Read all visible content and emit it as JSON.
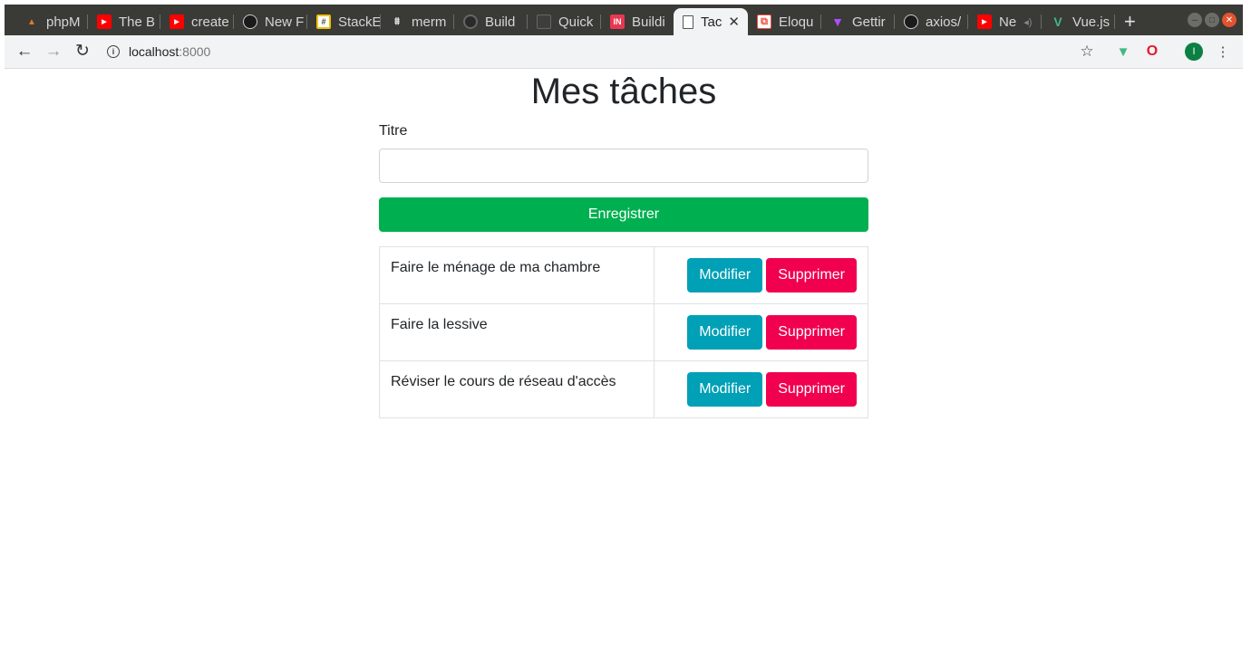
{
  "browser": {
    "tabs": [
      {
        "title": "phpM",
        "favicon": "phpmyadmin-icon",
        "color": "#e07b1f"
      },
      {
        "title": "The B",
        "favicon": "youtube-icon",
        "color": "#ff0000"
      },
      {
        "title": "create",
        "favicon": "youtube-icon",
        "color": "#ff0000"
      },
      {
        "title": "New F",
        "favicon": "github-icon",
        "color": "#1b1b1b"
      },
      {
        "title": "StackE",
        "favicon": "stackedit-icon",
        "color": "#f0c000"
      },
      {
        "title": "merm",
        "favicon": "mermaid-icon",
        "color": "#5a5a5a"
      },
      {
        "title": "Build",
        "favicon": "build-icon",
        "color": "#444444"
      },
      {
        "title": "Quick",
        "favicon": "document-icon",
        "color": "#555555"
      },
      {
        "title": "Buildi",
        "favicon": "in-icon",
        "color": "#e8384f"
      },
      {
        "title": "Tac",
        "favicon": "page-icon",
        "color": "#ffffff",
        "active": true
      },
      {
        "title": "Eloqu",
        "favicon": "laravel-icon",
        "color": "#f05340"
      },
      {
        "title": "Gettir",
        "favicon": "vite-icon",
        "color": "#a044ff"
      },
      {
        "title": "axios/",
        "favicon": "github-icon",
        "color": "#1b1b1b"
      },
      {
        "title": "Ne",
        "favicon": "youtube-icon",
        "color": "#ff0000"
      },
      {
        "title": "Vue.js",
        "favicon": "vue-icon",
        "color": "#41b883"
      }
    ],
    "url_host": "localhost",
    "url_port": ":8000",
    "profile_initial": "I"
  },
  "page": {
    "title": "Mes tâches",
    "field_label": "Titre",
    "field_value": "",
    "save_label": "Enregistrer",
    "edit_label": "Modifier",
    "delete_label": "Supprimer",
    "tasks": [
      {
        "name": "Faire le ménage de ma chambre"
      },
      {
        "name": "Faire la lessive"
      },
      {
        "name": "Réviser le cours de réseau d'accès"
      }
    ]
  },
  "colors": {
    "save": "#00b050",
    "edit": "#00a0b6",
    "delete": "#f0004f"
  }
}
